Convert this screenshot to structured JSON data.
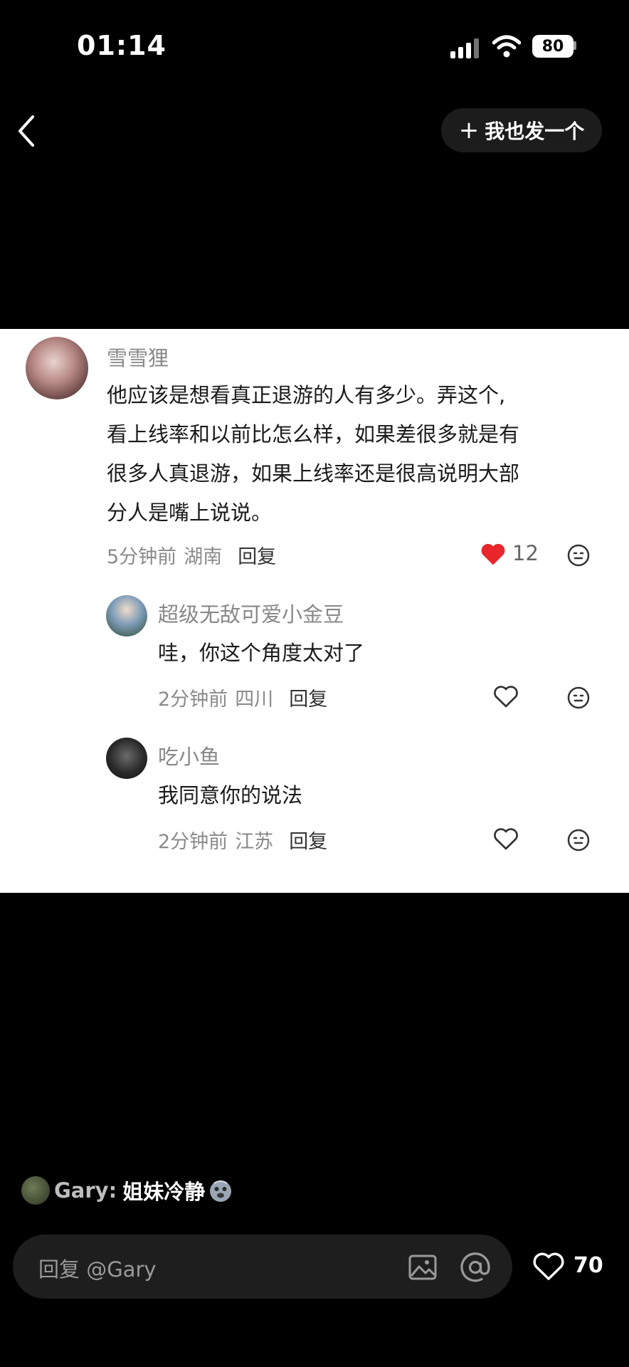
{
  "status": {
    "time": "01:14",
    "battery": "80"
  },
  "nav": {
    "post_button": "我也发一个",
    "post_plus": "+"
  },
  "comment": {
    "username": "雪雪狸",
    "lines": [
      "他应该是想看真正退游的人有多少。弄这个,",
      "看上线率和以前比怎么样，如果差很多就是有",
      "很多人真退游，如果上线率还是很高说明大部",
      "分人是嘴上说说。"
    ],
    "time": "5分钟前",
    "location": "湖南",
    "reply": "回复",
    "likes": "12",
    "liked": true
  },
  "replies": [
    {
      "username": "超级无敌可爱小金豆",
      "text": "哇，你这个角度太对了",
      "time": "2分钟前",
      "location": "四川",
      "reply": "回复"
    },
    {
      "username": "吃小鱼",
      "text": "我同意你的说法",
      "time": "2分钟前",
      "location": "江苏",
      "reply": "回复"
    }
  ],
  "bottom": {
    "top_comment_user": "Gary:",
    "top_comment_text": "姐妹冷静",
    "reply_placeholder": "回复 @Gary",
    "total_likes": "70"
  },
  "colors": {
    "like_red": "#e8262c",
    "card_bg": "#ffffff",
    "reply_box": "#1e1e1e"
  }
}
